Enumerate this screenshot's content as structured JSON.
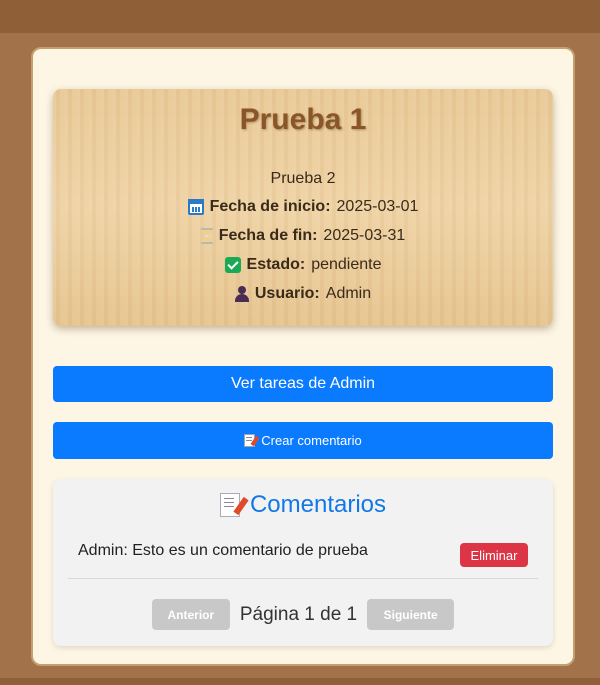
{
  "task": {
    "title": "Prueba 1",
    "description": "Prueba 2",
    "start_label": "Fecha de inicio:",
    "start_value": "2025-03-01",
    "end_label": "Fecha de fin:",
    "end_value": "2025-03-31",
    "status_label": "Estado:",
    "status_value": "pendiente",
    "user_label": "Usuario:",
    "user_value": "Admin"
  },
  "actions": {
    "view_tasks_label": "Ver tareas de Admin",
    "create_comment_label": "Crear comentario"
  },
  "comments": {
    "title": "Comentarios",
    "items": [
      {
        "author": "Admin",
        "text": "Admin: Esto es un comentario de prueba",
        "delete_label": "Eliminar"
      }
    ],
    "pagination": {
      "prev_label": "Anterior",
      "page_info": "Página 1 de 1",
      "next_label": "Siguiente"
    }
  },
  "colors": {
    "primary": "#0a7bff",
    "danger": "#dc3545",
    "accent_title": "#8a5628",
    "comments_title": "#1278e6"
  },
  "icons": [
    "calendar-icon",
    "hourglass-icon",
    "check-icon",
    "user-icon",
    "memo-icon"
  ]
}
